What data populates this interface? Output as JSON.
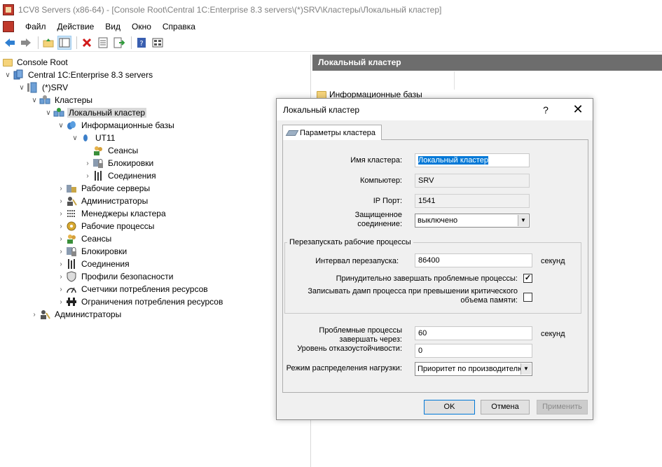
{
  "window": {
    "title": "1CV8 Servers (x86-64) - [Console Root\\Central 1C:Enterprise 8.3 servers\\(*)SRV\\Кластеры\\Локальный кластер]"
  },
  "menu": [
    "Файл",
    "Действие",
    "Вид",
    "Окно",
    "Справка"
  ],
  "toolbar": {
    "back_icon": "arrow-left",
    "forward_icon": "arrow-right",
    "up_icon": "folder-up",
    "tree_icon": "show-tree",
    "delete_icon": "red-x",
    "properties_icon": "properties",
    "export_icon": "export-list",
    "help_icon": "help",
    "view_icon": "view-pane"
  },
  "tree": {
    "root": "Console Root",
    "central": "Central 1C:Enterprise 8.3 servers",
    "srv": "(*)SRV",
    "clusters": "Кластеры",
    "local_cluster": "Локальный кластер",
    "infobases": "Информационные базы",
    "ut11": "UT11",
    "ut_sessions": "Сеансы",
    "ut_locks": "Блокировки",
    "ut_connections": "Соединения",
    "working_servers": "Рабочие серверы",
    "administrators": "Администраторы",
    "cluster_managers": "Менеджеры кластера",
    "working_processes": "Рабочие процессы",
    "sessions": "Сеансы",
    "locks": "Блокировки",
    "connections": "Соединения",
    "security_profiles": "Профили безопасности",
    "resource_counters": "Счетчики потребления ресурсов",
    "resource_limits": "Ограничения потребления ресурсов",
    "server_administrators": "Администраторы"
  },
  "right_pane": {
    "header": "Локальный кластер",
    "item": "Информационные базы"
  },
  "dialog": {
    "title": "Локальный кластер",
    "help": "?",
    "close": "✕",
    "tab": "Параметры кластера",
    "cluster_name_label": "Имя кластера:",
    "cluster_name_value": "Локальный кластер",
    "computer_label": "Компьютер:",
    "computer_value": "SRV",
    "ip_port_label": "IP Порт:",
    "ip_port_value": "1541",
    "secure_label_1": "Защищенное",
    "secure_label_2": "соединение:",
    "secure_value": "выключено",
    "restart_group": "Перезапускать рабочие процессы",
    "restart_interval_label": "Интервал перезапуска:",
    "restart_interval_value": "86400",
    "restart_interval_unit": "секунд",
    "force_terminate_label": "Принудительно завершать проблемные процессы:",
    "force_terminate_checked": true,
    "dump_label_1": "Записывать дамп процесса при превышении критического",
    "dump_label_2": "объема памяти:",
    "dump_checked": false,
    "problem_label_1": "Проблемные процессы",
    "problem_label_2": "завершать через:",
    "problem_value": "60",
    "problem_unit": "секунд",
    "fault_tolerance_label": "Уровень отказоустойчивости:",
    "fault_tolerance_value": "0",
    "load_balance_label": "Режим распределения нагрузки:",
    "load_balance_value": "Приоритет по производителю",
    "ok": "OK",
    "cancel": "Отмена",
    "apply": "Применить"
  }
}
